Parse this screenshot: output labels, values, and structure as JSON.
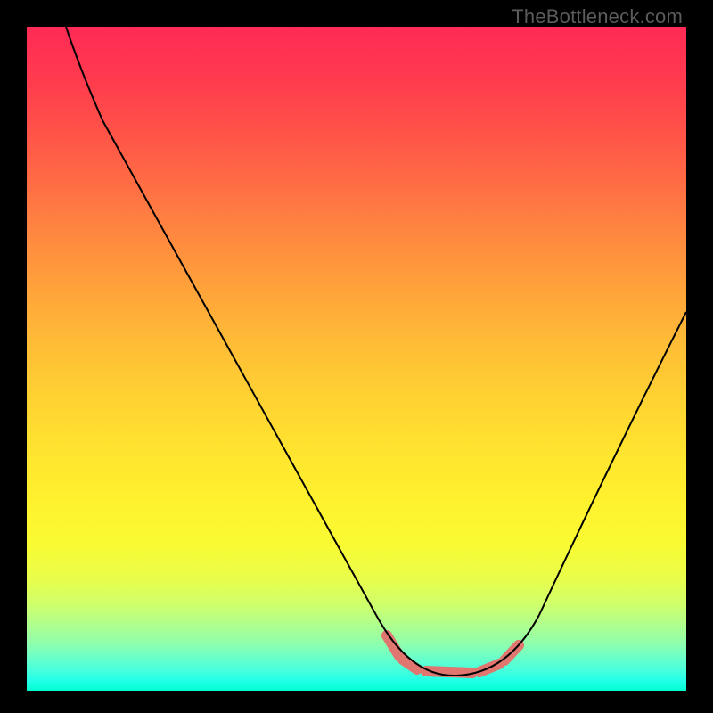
{
  "watermark": "TheBottleneck.com",
  "colors": {
    "gradient_top": "#ff2a55",
    "gradient_mid": "#ffe42f",
    "gradient_bottom": "#00ffd0",
    "curve": "#000000",
    "marker_band": "#e0766f",
    "frame": "#000000",
    "watermark_text": "#5b5b5b"
  },
  "chart_data": {
    "type": "line",
    "title": "",
    "xlabel": "",
    "ylabel": "",
    "xlim": [
      0,
      100
    ],
    "ylim": [
      0,
      100
    ],
    "grid": false,
    "legend": false,
    "annotations": [
      "TheBottleneck.com"
    ],
    "series": [
      {
        "name": "curve",
        "x": [
          6,
          11,
          20,
          30,
          40,
          50,
          53,
          57,
          61,
          65,
          68,
          71,
          74,
          78,
          84,
          90,
          100
        ],
        "values": [
          100,
          86,
          70,
          52,
          34,
          16,
          11,
          6,
          3,
          2,
          2,
          4,
          8,
          15,
          28,
          42,
          57
        ]
      }
    ],
    "highlight_band_x": [
      55,
      75
    ]
  }
}
